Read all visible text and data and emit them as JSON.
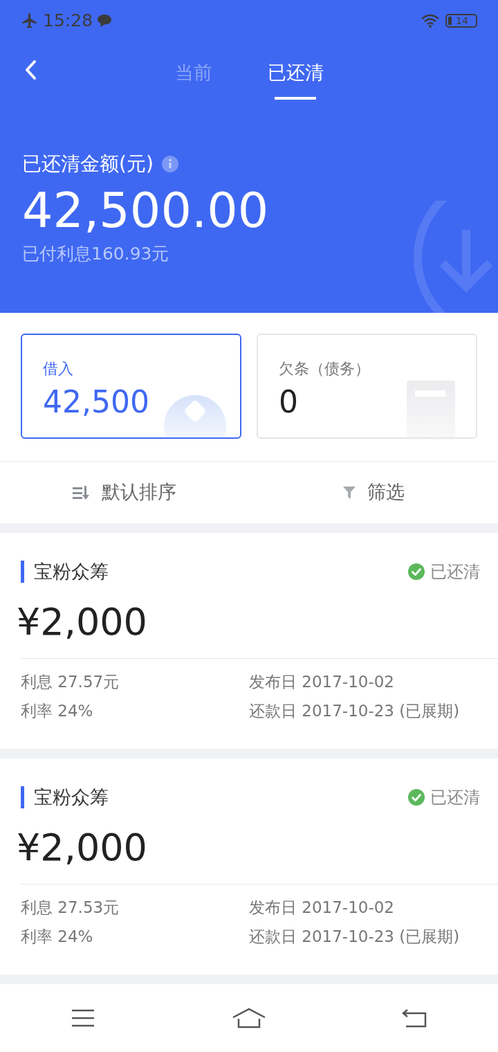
{
  "status_bar": {
    "time": "15:28",
    "battery": "14"
  },
  "tabs": [
    {
      "label": "当前",
      "selected": false
    },
    {
      "label": "已还清",
      "selected": true
    }
  ],
  "summary": {
    "title": "已还清金额(元)",
    "amount": "42,500.00",
    "interest": "已付利息160.93元"
  },
  "stat_cards": [
    {
      "label": "借入",
      "value": "42,500",
      "selected": true,
      "kind": "coin"
    },
    {
      "label": "欠条（债务）",
      "value": "0",
      "selected": false,
      "kind": "note"
    }
  ],
  "toolbar": [
    {
      "label": "默认排序",
      "kind": "sort"
    },
    {
      "label": "筛选",
      "kind": "filter"
    }
  ],
  "loans": [
    {
      "name": "宝粉众筹",
      "status": "已还清",
      "amount": "¥2,000",
      "interest": "利息 27.57元",
      "rate": "利率 24%",
      "publish_date": "发布日 2017-10-02",
      "due_date": "还款日 2017-10-23 (已展期)"
    },
    {
      "name": "宝粉众筹",
      "status": "已还清",
      "amount": "¥2,000",
      "interest": "利息 27.53元",
      "rate": "利率 24%",
      "publish_date": "发布日 2017-10-02",
      "due_date": "还款日 2017-10-23 (已展期)"
    }
  ]
}
